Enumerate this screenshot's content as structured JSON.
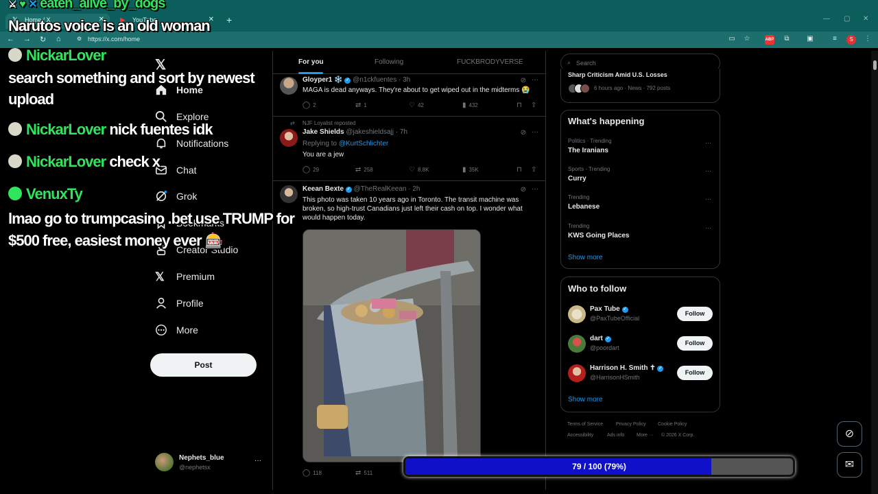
{
  "browser": {
    "tabs": [
      {
        "label": "Home / X"
      },
      {
        "label": "YouTube"
      }
    ],
    "new_tab": "+",
    "url": "https://x.com/home"
  },
  "nav": {
    "items": [
      {
        "label": "Home"
      },
      {
        "label": "Explore"
      },
      {
        "label": "Notifications"
      },
      {
        "label": "Chat"
      },
      {
        "label": "Grok"
      },
      {
        "label": "Bookmarks"
      },
      {
        "label": "Creator Studio"
      },
      {
        "label": "Premium"
      },
      {
        "label": "Profile"
      },
      {
        "label": "More"
      }
    ],
    "post_label": "Post",
    "profile": {
      "name": "Nephets_blue",
      "handle": "@nephetsx",
      "more": "···"
    }
  },
  "feed": {
    "tabs": [
      {
        "label": "For you"
      },
      {
        "label": "Following"
      },
      {
        "label": "FUCKBRODYVERSE"
      }
    ],
    "tweets": [
      {
        "name": "Gloyper1 ❄️",
        "handle": "@n1ckfuentes · 3h",
        "text": "MAGA is dead anyways. They're about to get wiped out in the midterms 😭",
        "replies": "2",
        "reposts": "1",
        "likes": "42",
        "views": "432"
      },
      {
        "repost_note": "NJF Loyalist reposted",
        "name": "Jake Shields",
        "handle": "@jakeshieldsajj · 7h",
        "replying_prefix": "Replying to ",
        "replying_to": "@KurtSchlichter",
        "text": "You are a jew",
        "replies": "29",
        "reposts": "258",
        "likes": "8.8K",
        "views": "35K"
      },
      {
        "name": "Keean Bexte",
        "handle": "@TheRealKeean · 2h",
        "text": "This photo was taken 10 years ago in Toronto. The transit machine was broken, so high-trust Canadians just left their cash on top. I wonder what would happen today.",
        "replies": "118",
        "reposts": "511"
      }
    ]
  },
  "right": {
    "search_placeholder": "Search",
    "news_snippet": {
      "title": "Sharp Criticism Amid U.S. Losses",
      "meta": "6 hours ago · News · 792 posts"
    },
    "happening": {
      "title": "What's happening",
      "trends": [
        {
          "meta": "Politics · Trending",
          "name": "The Iranians"
        },
        {
          "meta": "Sports · Trending",
          "name": "Curry"
        },
        {
          "meta": "Trending",
          "name": "Lebanese"
        },
        {
          "meta": "Trending",
          "name": "KWS Going Places"
        }
      ],
      "show_more": "Show more"
    },
    "who_to_follow": {
      "title": "Who to follow",
      "users": [
        {
          "name": "Pax Tube",
          "handle": "@PaxTubeOfficial"
        },
        {
          "name": "dart",
          "handle": "@poordart"
        },
        {
          "name": "Harrison H. Smith ✝",
          "handle": "@HarrisonHSmith"
        }
      ],
      "follow_label": "Follow",
      "show_more": "Show more"
    },
    "footer": {
      "links": [
        "Terms of Service",
        "Privacy Policy",
        "Cookie Policy",
        "Accessibility",
        "Ads info",
        "More ···",
        "© 2026 X Corp."
      ]
    }
  },
  "overlay": {
    "header_user": "eaten_alive_by_dogs",
    "chat": [
      {
        "user": "",
        "text": "Narutos voice is an old woman"
      },
      {
        "user": "NickarLover",
        "text": ""
      },
      {
        "user": "",
        "text": "search something and sort by newest"
      },
      {
        "user": "",
        "text": "upload"
      },
      {
        "user": "NickarLover",
        "text": "nick fuentes idk"
      },
      {
        "user": "NickarLover",
        "text": "check x"
      },
      {
        "user": "VenuxTy",
        "text": ""
      },
      {
        "user": "",
        "text": "lmao go to trumpcasino .bet use TRUMP for"
      },
      {
        "user": "",
        "text": "$500 free, easiest money ever 🎰"
      }
    ],
    "progress": {
      "label": "79 / 100 (79%)",
      "value": 79,
      "max": 100
    }
  },
  "colors": {
    "accent": "#1d9bf0",
    "chat_user": "#2ee55b",
    "progress_fill": "#1010c8",
    "browser": "#0b5e5c"
  }
}
